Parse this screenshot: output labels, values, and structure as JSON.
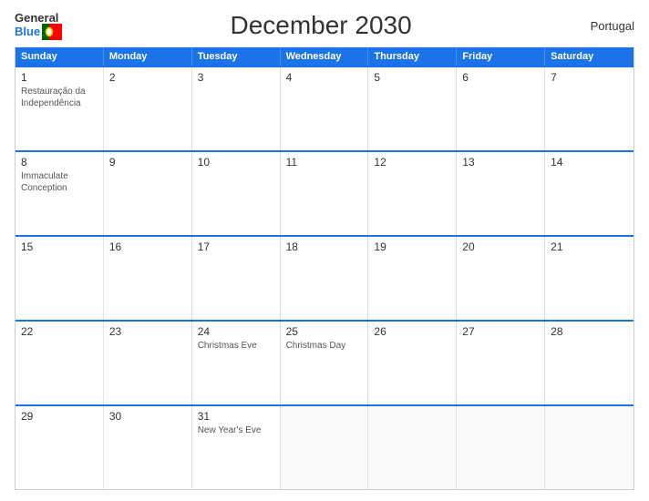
{
  "header": {
    "logo_general": "General",
    "logo_blue": "Blue",
    "title": "December 2030",
    "country": "Portugal"
  },
  "days_of_week": [
    "Sunday",
    "Monday",
    "Tuesday",
    "Wednesday",
    "Thursday",
    "Friday",
    "Saturday"
  ],
  "weeks": [
    [
      {
        "date": "1",
        "events": [
          "Restauração da",
          "Independência"
        ]
      },
      {
        "date": "2",
        "events": []
      },
      {
        "date": "3",
        "events": []
      },
      {
        "date": "4",
        "events": []
      },
      {
        "date": "5",
        "events": []
      },
      {
        "date": "6",
        "events": []
      },
      {
        "date": "7",
        "events": []
      }
    ],
    [
      {
        "date": "8",
        "events": [
          "Immaculate",
          "Conception"
        ]
      },
      {
        "date": "9",
        "events": []
      },
      {
        "date": "10",
        "events": []
      },
      {
        "date": "11",
        "events": []
      },
      {
        "date": "12",
        "events": []
      },
      {
        "date": "13",
        "events": []
      },
      {
        "date": "14",
        "events": []
      }
    ],
    [
      {
        "date": "15",
        "events": []
      },
      {
        "date": "16",
        "events": []
      },
      {
        "date": "17",
        "events": []
      },
      {
        "date": "18",
        "events": []
      },
      {
        "date": "19",
        "events": []
      },
      {
        "date": "20",
        "events": []
      },
      {
        "date": "21",
        "events": []
      }
    ],
    [
      {
        "date": "22",
        "events": []
      },
      {
        "date": "23",
        "events": []
      },
      {
        "date": "24",
        "events": [
          "Christmas Eve"
        ]
      },
      {
        "date": "25",
        "events": [
          "Christmas Day"
        ]
      },
      {
        "date": "26",
        "events": []
      },
      {
        "date": "27",
        "events": []
      },
      {
        "date": "28",
        "events": []
      }
    ],
    [
      {
        "date": "29",
        "events": []
      },
      {
        "date": "30",
        "events": []
      },
      {
        "date": "31",
        "events": [
          "New Year's Eve"
        ]
      },
      {
        "date": "",
        "events": []
      },
      {
        "date": "",
        "events": []
      },
      {
        "date": "",
        "events": []
      },
      {
        "date": "",
        "events": []
      }
    ]
  ]
}
